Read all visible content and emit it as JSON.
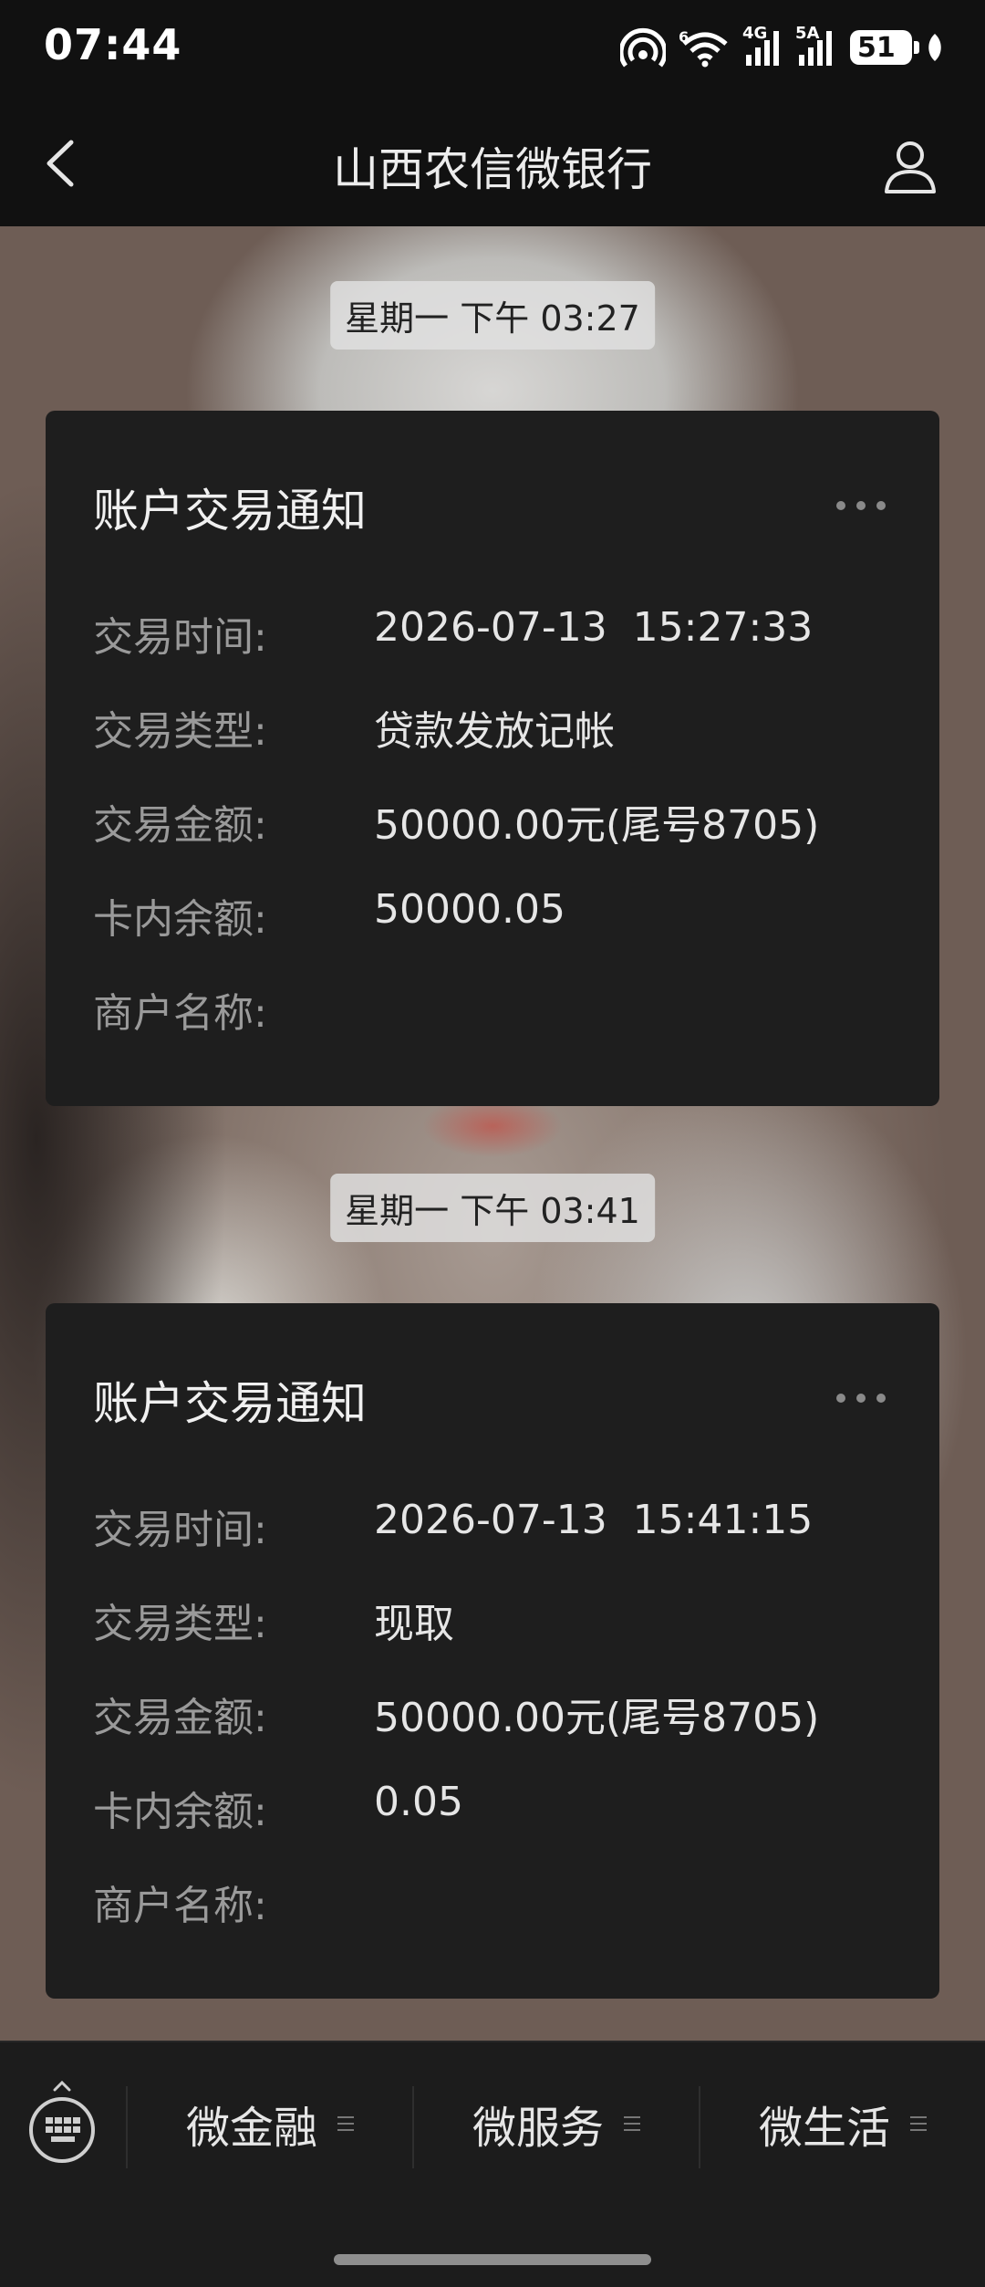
{
  "status_bar": {
    "time": "07:44",
    "network_1": "4G",
    "network_2": "5A",
    "battery": "51",
    "icons": [
      "hotspot-icon",
      "wifi-icon",
      "signal-icon",
      "signal-icon",
      "battery-icon",
      "leaf-icon"
    ]
  },
  "nav": {
    "title": "山西农信微银行",
    "back_icon": "chevron-left-icon",
    "profile_icon": "person-icon"
  },
  "messages": [
    {
      "timestamp": "星期一 下午 03:27",
      "title": "账户交易通知",
      "rows": [
        {
          "label": "交易时间:",
          "value": "2026-07-13  15:27:33"
        },
        {
          "label": "交易类型:",
          "value": "贷款发放记帐"
        },
        {
          "label": "交易金额:",
          "value": "50000.00元(尾号8705)"
        },
        {
          "label": "卡内余额:",
          "value": "50000.05"
        },
        {
          "label": "商户名称:",
          "value": ""
        }
      ]
    },
    {
      "timestamp": "星期一 下午 03:41",
      "title": "账户交易通知",
      "rows": [
        {
          "label": "交易时间:",
          "value": "2026-07-13  15:41:15"
        },
        {
          "label": "交易类型:",
          "value": "现取"
        },
        {
          "label": "交易金额:",
          "value": "50000.00元(尾号8705)"
        },
        {
          "label": "卡内余额:",
          "value": "0.05"
        },
        {
          "label": "商户名称:",
          "value": ""
        }
      ]
    }
  ],
  "bottom_menu": {
    "keyboard_icon": "keyboard-icon",
    "items": [
      {
        "label": "微金融"
      },
      {
        "label": "微服务"
      },
      {
        "label": "微生活"
      }
    ]
  }
}
